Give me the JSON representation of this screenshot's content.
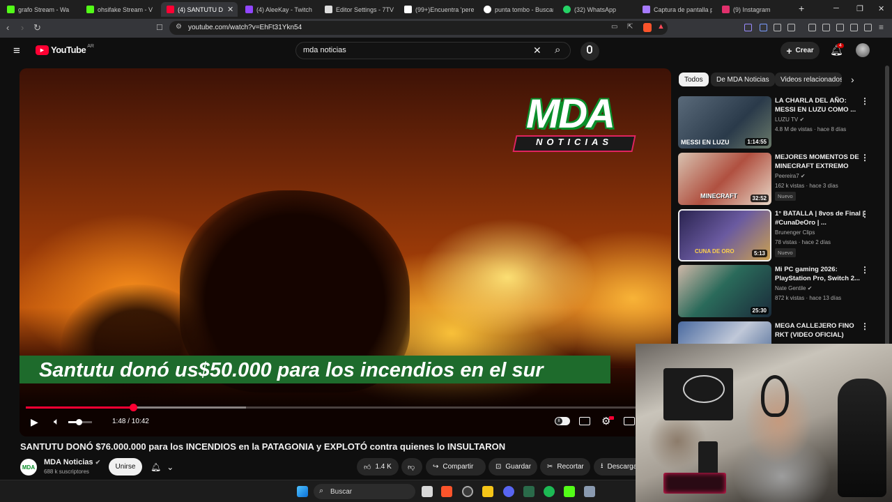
{
  "browser": {
    "tabs": [
      {
        "label": "grafo Stream - Wa",
        "color": "#53fc18"
      },
      {
        "label": "ohsifake Stream - V",
        "color": "#53fc18"
      },
      {
        "label": "(4) SANTUTU D",
        "color": "#ff0033"
      },
      {
        "label": "(4) AleeKay - Twitch",
        "color": "#9146ff"
      },
      {
        "label": "Editor Settings - 7TV",
        "color": "#dddddd"
      },
      {
        "label": "(99+)Encuentra 'perei",
        "color": "#ffffff"
      },
      {
        "label": "punta tombo - Buscar",
        "color": "#ffffff"
      },
      {
        "label": "(32) WhatsApp",
        "color": "#25d366"
      },
      {
        "label": "Captura de pantalla pc",
        "color": "#a77bff"
      },
      {
        "label": "(9) Instagram",
        "color": "#e1306c"
      }
    ],
    "new_tab_symbol": "+",
    "url": "youtube.com/watch?v=EhFt31Ykn54"
  },
  "header": {
    "logo_text": "YouTube",
    "country": "AR",
    "search_value": "mda noticias",
    "create_label": "Crear",
    "notification_count": "4"
  },
  "player": {
    "logo_main": "MDA",
    "logo_sub": "NOTICIAS",
    "caption": "Santutu donó us$50.000 para los incendios en el sur",
    "time_current": "1:48",
    "time_total": "10:42",
    "time_display": "1:48 / 10:42",
    "progress_fraction": 0.168,
    "buffered_fraction": 0.345,
    "volume_fraction": 0.45
  },
  "video": {
    "title": "SANTUTU DONÓ $76.000.000 para los INCENDIOS en la PATAGONIA y EXPLOTÓ contra quienes lo INSULTARON",
    "channel": "MDA Noticias",
    "channel_avatar_text": "MDA",
    "subscribers": "688 k suscriptores",
    "join_label": "Unirse",
    "likes": "1.4 K",
    "share_label": "Compartir",
    "save_label": "Guardar",
    "clip_label": "Recortar",
    "download_label": "Descargar"
  },
  "chips": [
    "Todos",
    "De MDA Noticias",
    "Videos relacionados"
  ],
  "related": [
    {
      "title": "LA CHARLA DEL AÑO: MESSI EN LUZU COMO ...",
      "channel": "LUZU TV",
      "meta": "4.8 M de vistas · hace 8 días",
      "duration": "1:14:55",
      "thumb_text": "MESSI EN LUZU",
      "badge": "",
      "thumb_color": "#3a4a5a"
    },
    {
      "title": "MEJORES MOMENTOS DE MINECRAFT EXTREMO",
      "channel": "Peereira7",
      "meta": "162 k vistas · hace 3 días",
      "duration": "32:52",
      "thumb_text": "MINECRAFT",
      "badge": "Nuevo",
      "thumb_color": "#c24a3a"
    },
    {
      "title": "1° BATALLA | 8vos de Final | #CunaDeOro | ...",
      "channel": "Brunenger Clips",
      "meta": "78 vistas · hace 2 días",
      "duration": "5:13",
      "thumb_text": "CUNA DE ORO",
      "badge": "Nuevo",
      "thumb_color": "#4a3a7a"
    },
    {
      "title": "Mi PC gaming 2026: PlayStation Pro, Switch 2...",
      "channel": "Nate Gentile",
      "meta": "872 k vistas · hace 13 días",
      "duration": "25:30",
      "thumb_text": "",
      "badge": "",
      "thumb_color": "#2a5a4a"
    },
    {
      "title": "MEGA CALLEJERO FINO RKT (VIDEO OFICIAL)",
      "channel": "",
      "meta": "",
      "duration": "",
      "thumb_text": "",
      "badge": "",
      "thumb_color": "#3a5a8a"
    }
  ],
  "taskbar": {
    "search_label": "Buscar"
  }
}
